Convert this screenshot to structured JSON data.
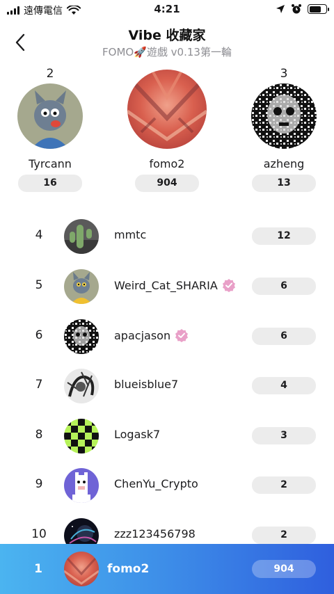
{
  "status_bar": {
    "carrier": "遠傳電信",
    "time": "4:21"
  },
  "header": {
    "title": "Vibe 收藏家",
    "subtitle": "FOMO🚀遊戲 v0.13第一輪"
  },
  "podium": [
    {
      "rank": "2",
      "name": "Tyrcann",
      "count": "16",
      "avatar": "cat-avatar"
    },
    {
      "rank": "",
      "name": "fomo2",
      "count": "904",
      "avatar": "orange-texture-avatar"
    },
    {
      "rank": "3",
      "name": "azheng",
      "count": "13",
      "avatar": "bw-pattern-avatar"
    }
  ],
  "list": [
    {
      "rank": "4",
      "name": "mmtc",
      "count": "12",
      "verified": false,
      "avatar": "cactus-avatar"
    },
    {
      "rank": "5",
      "name": "Weird_Cat_SHARIA",
      "count": "6",
      "verified": true,
      "avatar": "cat-avatar"
    },
    {
      "rank": "6",
      "name": "apacjason",
      "count": "6",
      "verified": true,
      "avatar": "bw-pattern-avatar"
    },
    {
      "rank": "7",
      "name": "blueisblue7",
      "count": "4",
      "verified": false,
      "avatar": "sketch-avatar"
    },
    {
      "rank": "8",
      "name": "Logask7",
      "count": "3",
      "verified": false,
      "avatar": "checker-avatar"
    },
    {
      "rank": "9",
      "name": "ChenYu_Crypto",
      "count": "2",
      "verified": false,
      "avatar": "llama-avatar"
    },
    {
      "rank": "10",
      "name": "zzz123456798",
      "count": "2",
      "verified": false,
      "avatar": "space-avatar"
    }
  ],
  "my_rank": {
    "rank": "1",
    "name": "fomo2",
    "count": "904"
  },
  "colors": {
    "pill_bg": "#ececec",
    "bar_gradient_start": "#4bb4f0",
    "bar_gradient_end": "#2f5fde",
    "verified_badge": "#e9a0c8"
  }
}
